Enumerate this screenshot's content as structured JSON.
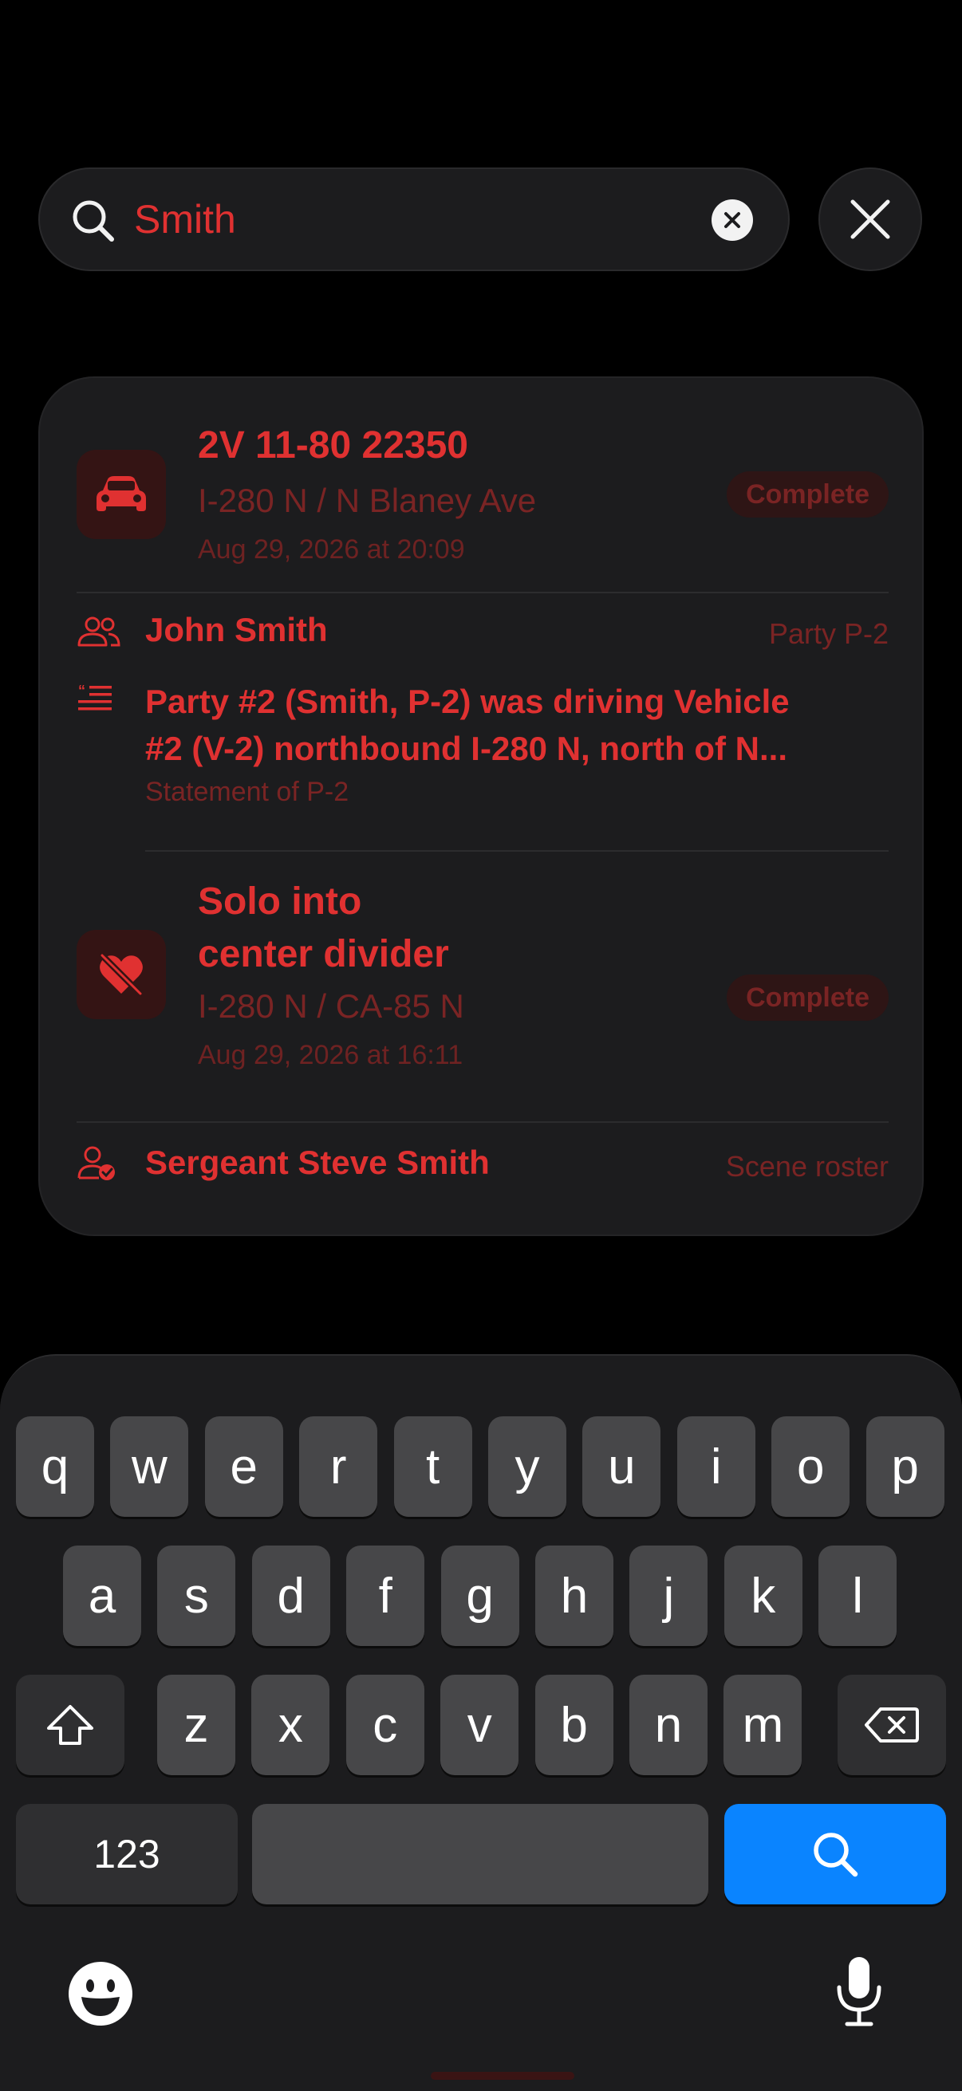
{
  "search": {
    "query": "Smith"
  },
  "results": {
    "incident_1": {
      "title": "2V 11-80 22350",
      "location": "I-280 N / N Blaney Ave",
      "datetime": "Aug 29, 2026 at 20:09",
      "status": "Complete",
      "icon": "car-icon"
    },
    "party_match": {
      "name": "John Smith",
      "role": "Party P-2",
      "icon": "people-icon"
    },
    "statement_match": {
      "line1": "Party #2 (Smith, P-2) was driving Vehicle",
      "line2": "#2 (V-2) northbound I-280 N, north of N...",
      "caption": "Statement of P-2",
      "icon": "quote-text-icon"
    },
    "incident_2": {
      "title_line1": "Solo into",
      "title_line2": "center divider",
      "location": "I-280 N / CA-85 N",
      "datetime": "Aug 29, 2026 at 16:11",
      "status": "Complete",
      "icon": "heart-slash-icon"
    },
    "roster_match": {
      "name": "Sergeant Steve Smith",
      "source": "Scene roster",
      "icon": "person-check-icon"
    }
  },
  "keyboard": {
    "row1": [
      "q",
      "w",
      "e",
      "r",
      "t",
      "y",
      "u",
      "i",
      "o",
      "p"
    ],
    "row2": [
      "a",
      "s",
      "d",
      "f",
      "g",
      "h",
      "j",
      "k",
      "l"
    ],
    "row3": [
      "z",
      "x",
      "c",
      "v",
      "b",
      "n",
      "m"
    ],
    "numbers_label": "123"
  },
  "colors": {
    "accent": "#e03131",
    "dim_accent": "#7a2424",
    "card_bg": "#1c1c1e",
    "search_key": "#0a84ff"
  }
}
